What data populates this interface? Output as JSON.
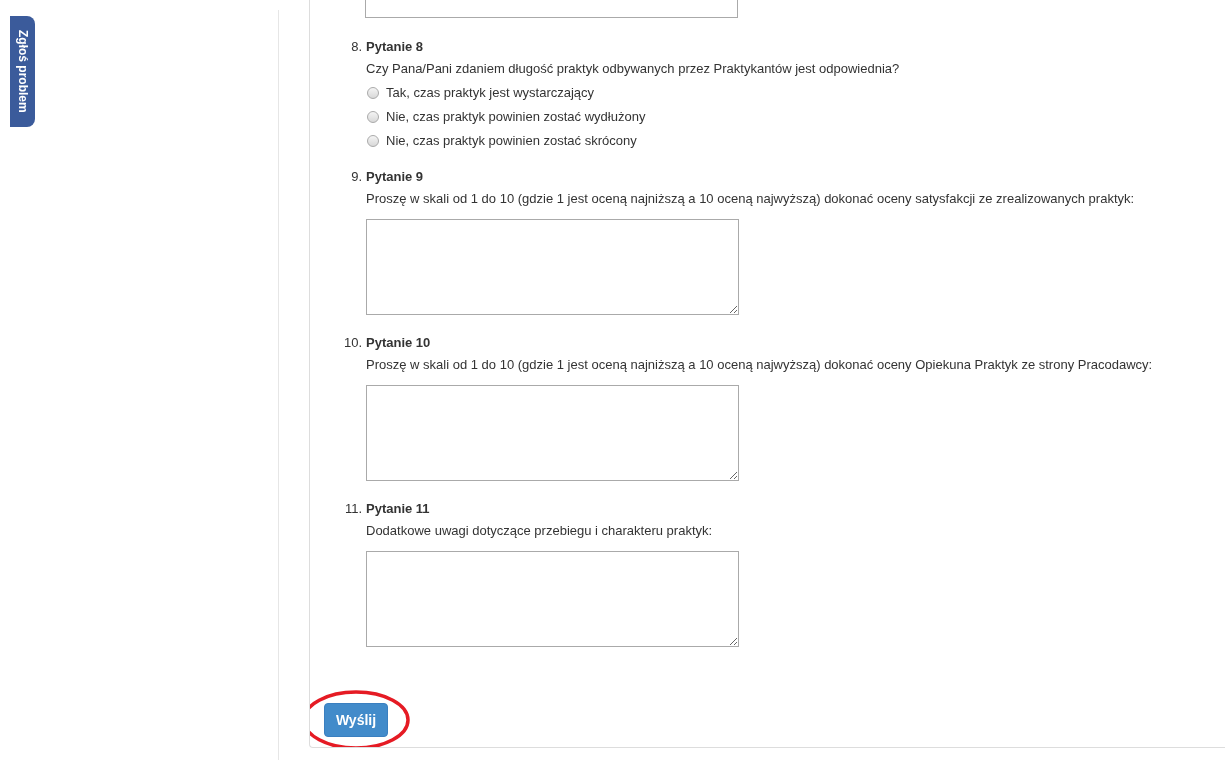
{
  "report_tab": {
    "label": "Zgłoś problem"
  },
  "top_field_visible": true,
  "questions": [
    {
      "kind": "choice",
      "number": "8.",
      "title": "Pytanie 8",
      "prompt": "Czy Pana/Pani zdaniem długość praktyk odbywanych przez Praktykantów jest odpowiednia?",
      "options": [
        {
          "label": "Tak, czas praktyk jest wystarczający",
          "selected": false
        },
        {
          "label": "Nie, czas praktyk powinien zostać wydłużony",
          "selected": false
        },
        {
          "label": "Nie, czas praktyk powinien zostać skrócony",
          "selected": false
        }
      ]
    },
    {
      "kind": "text",
      "number": "9.",
      "title": "Pytanie 9",
      "prompt": "Proszę w skali od 1 do 10 (gdzie 1 jest oceną najniższą a 10 oceną najwyższą) dokonać oceny satysfakcji ze zrealizowanych praktyk:"
    },
    {
      "kind": "text",
      "number": "10.",
      "title": "Pytanie 10",
      "prompt": "Proszę w skali od 1 do 10 (gdzie 1 jest oceną najniższą a 10 oceną najwyższą) dokonać oceny Opiekuna Praktyk ze strony Pracodawcy:"
    },
    {
      "kind": "text",
      "number": "11.",
      "title": "Pytanie 11",
      "prompt": "Dodatkowe uwagi dotyczące przebiegu i charakteru praktyk:"
    }
  ],
  "submit": {
    "label": "Wyślij",
    "circled": true
  }
}
